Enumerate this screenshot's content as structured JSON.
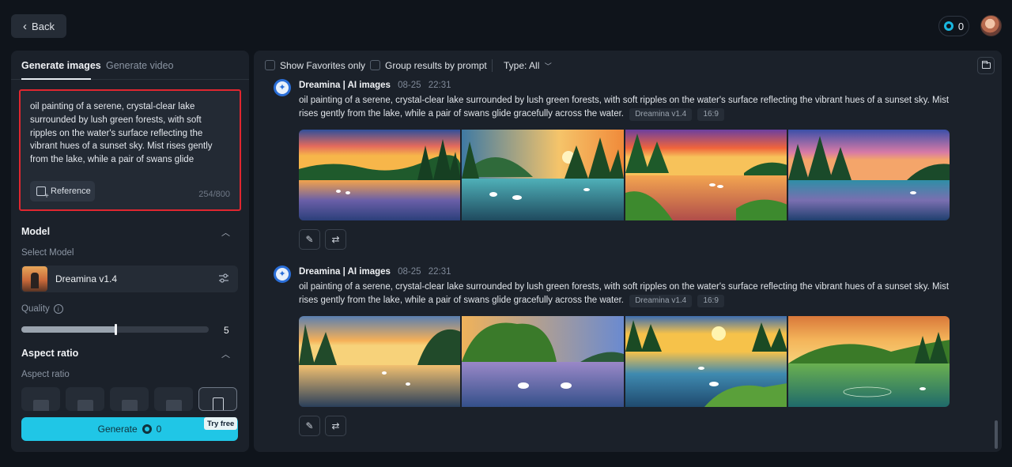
{
  "topbar": {
    "back_label": "Back",
    "credits": "0"
  },
  "left": {
    "tabs": [
      "Generate images",
      "Generate video"
    ],
    "prompt": "oil painting of a serene, crystal-clear lake surrounded by lush green forests, with soft ripples on the water's surface reflecting the vibrant hues of a sunset sky. Mist rises gently from the lake, while a pair of swans glide gracefully across the water.",
    "reference_label": "Reference",
    "char_count": "254/800",
    "model_section": "Model",
    "select_model_label": "Select Model",
    "model_name": "Dreamina v1.4",
    "quality_label": "Quality",
    "quality_value": "5",
    "quality_fraction": 0.5,
    "aspect_section": "Aspect ratio",
    "aspect_label": "Aspect ratio",
    "generate_label": "Generate",
    "generate_cost": "0",
    "try_free": "Try free"
  },
  "main": {
    "filters": {
      "favorites": "Show Favorites only",
      "group": "Group results by prompt",
      "type": "Type: All"
    },
    "results": [
      {
        "name": "Dreamina | AI images",
        "date": "08-25",
        "time": "22:31",
        "prompt": "oil painting of a serene, crystal-clear lake surrounded by lush green forests, with soft ripples on the water's surface reflecting the vibrant hues of a sunset sky. Mist rises gently from the lake, while a pair of swans glide gracefully across the water.",
        "model_chip": "Dreamina v1.4",
        "ratio_chip": "16:9"
      },
      {
        "name": "Dreamina | AI images",
        "date": "08-25",
        "time": "22:31",
        "prompt": "oil painting of a serene, crystal-clear lake surrounded by lush green forests, with soft ripples on the water's surface reflecting the vibrant hues of a sunset sky. Mist rises gently from the lake, while a pair of swans glide gracefully across the water.",
        "model_chip": "Dreamina v1.4",
        "ratio_chip": "16:9"
      }
    ]
  },
  "colors": {
    "accent": "#20c6e6",
    "highlight_border": "#e0262f",
    "panel": "#1b212a",
    "background": "#0f141b"
  },
  "icons": [
    "chevron-left-icon",
    "coin-icon",
    "avatar",
    "reference-icon",
    "chevron-up-icon",
    "settings-sliders-icon",
    "info-icon",
    "folder-icon",
    "dreamina-logo-icon",
    "edit-icon",
    "regenerate-icon",
    "chevron-down-icon"
  ]
}
